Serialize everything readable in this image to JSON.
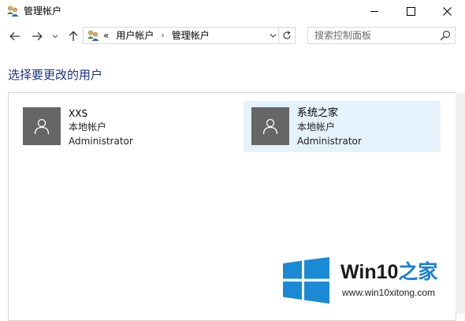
{
  "window": {
    "title": "管理帐户"
  },
  "address_bar": {
    "overflow_glyph": "«",
    "breadcrumbs": [
      "用户帐户",
      "管理帐户"
    ],
    "separator": "›"
  },
  "search": {
    "placeholder": "搜索控制面板"
  },
  "main": {
    "heading": "选择要更改的用户",
    "users": [
      {
        "name": "XXS",
        "type": "本地帐户",
        "role": "Administrator",
        "selected": false
      },
      {
        "name": "系统之家",
        "type": "本地帐户",
        "role": "Administrator",
        "selected": true
      }
    ]
  },
  "watermark": {
    "brand_prefix": "Win10",
    "brand_suffix": "之家",
    "url": "www.win10xitong.com"
  },
  "colors": {
    "heading": "#1e3287",
    "avatar": "#666666",
    "selected_tile": "#e5f1fb",
    "logo_blue": "#1a8ad4",
    "brand_blue": "#1a7fd2"
  },
  "icons": {
    "app": "users-icon",
    "back": "arrow-left-icon",
    "forward": "arrow-right-icon",
    "recent": "chevron-down-icon",
    "up": "arrow-up-icon",
    "refresh": "refresh-icon",
    "search": "search-icon",
    "avatar": "user-silhouette-icon"
  }
}
